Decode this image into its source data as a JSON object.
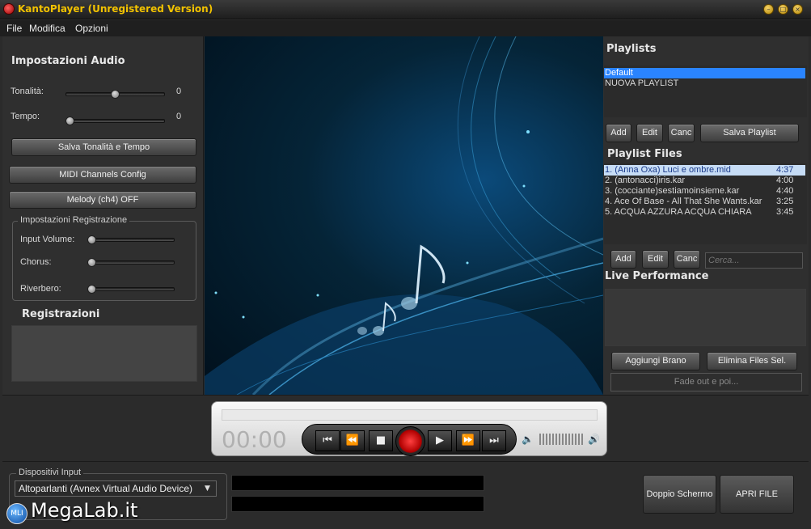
{
  "window": {
    "title": "KantoPlayer (Unregistered Version)"
  },
  "menu": [
    "File",
    "Modifica",
    "Opzioni"
  ],
  "audio": {
    "heading": "Impostazioni Audio",
    "tonalita_label": "Tonalità:",
    "tonalita_value": "0",
    "tempo_label": "Tempo:",
    "tempo_value": "0",
    "save_button": "Salva Tonalità e Tempo",
    "midi_button": "MIDI Channels Config",
    "melody_button": "Melody (ch4) OFF"
  },
  "recording": {
    "group_title": "Impostazioni Registrazione",
    "input_volume_label": "Input Volume:",
    "chorus_label": "Chorus:",
    "riverbero_label": "Riverbero:",
    "registrazioni_heading": "Registrazioni"
  },
  "playlists": {
    "heading": "Playlists",
    "items": [
      "Default",
      "NUOVA PLAYLIST"
    ],
    "add": "Add",
    "edit": "Edit",
    "canc": "Canc",
    "save": "Salva Playlist"
  },
  "playlist_files": {
    "heading": "Playlist Files",
    "rows": [
      {
        "title": "1. (Anna Oxa) Luci e ombre.mid",
        "duration": "4:37"
      },
      {
        "title": "2. (antonacci)iris.kar",
        "duration": "4:00"
      },
      {
        "title": "3. (cocciante)sestiamoinsieme.kar",
        "duration": "4:40"
      },
      {
        "title": "4. Ace Of Base - All That She Wants.kar",
        "duration": "3:25"
      },
      {
        "title": "5. ACQUA AZZURA ACQUA CHIARA",
        "duration": "3:45"
      }
    ],
    "add": "Add",
    "edit": "Edit",
    "canc": "Canc",
    "search_placeholder": "Cerca..."
  },
  "live": {
    "heading": "Live Performance",
    "add_song": "Aggiungi Brano",
    "remove_files": "Elimina Files Sel.",
    "fade": "Fade out e poi..."
  },
  "player": {
    "time": "00:00",
    "icons": [
      "prev-track-icon",
      "rewind-icon",
      "stop-icon",
      "record-icon",
      "play-icon",
      "fast-forward-icon",
      "next-track-icon"
    ]
  },
  "bottom": {
    "input_group_title": "Dispositivi Input",
    "input_device": "Altoparlanti (Avnex Virtual Audio Device)",
    "double_screen": "Doppio Schermo",
    "open_file": "APRI FILE"
  },
  "watermark": "MegaLab.it"
}
